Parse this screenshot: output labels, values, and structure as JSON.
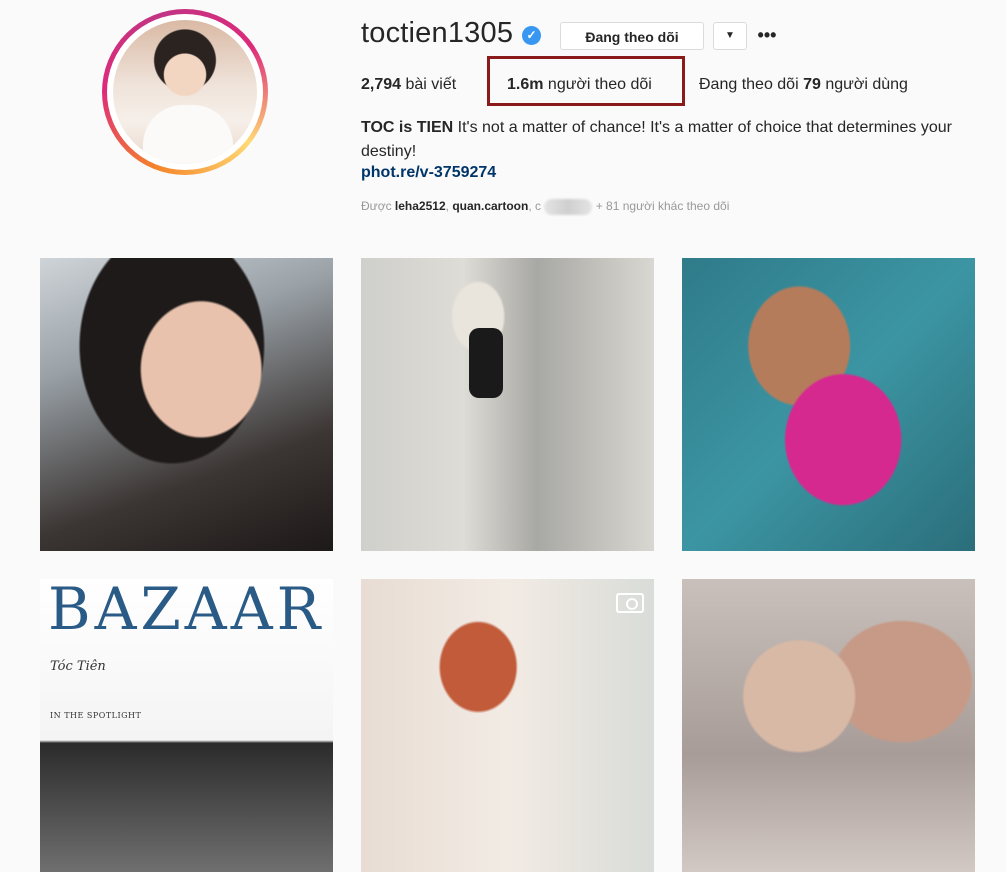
{
  "profile": {
    "username": "toctien1305",
    "verified_mark": "✓",
    "follow_button": "Đang theo dõi",
    "dropdown_icon": "▼",
    "more_icon": "•••",
    "stats": {
      "posts_count": "2,794",
      "posts_label": "bài viết",
      "followers_count": "1.6m",
      "followers_label": "người theo dõi",
      "following_prefix": "Đang theo dõi",
      "following_count": "79",
      "following_label": "người dùng"
    },
    "bio": {
      "name": "TOC is TIEN",
      "text": "It's not a matter of chance! It's a matter of choice that determines your destiny!",
      "link": "phot.re/v-3759274"
    },
    "followed_by": {
      "prefix": "Được",
      "user1": "leha2512",
      "sep": ",",
      "user2": "quan.cartoon",
      "sep2": ", c",
      "suffix": "+ 81 người khác theo dõi"
    }
  },
  "posts": {
    "cover_title": "BAZAAR",
    "cover_name": "Tóc Tiên",
    "cover_sub": "IN THE SPOTLIGHT"
  },
  "colors": {
    "accent_link": "#003569",
    "verified": "#3897f0",
    "highlight": "#8b1a1a"
  }
}
